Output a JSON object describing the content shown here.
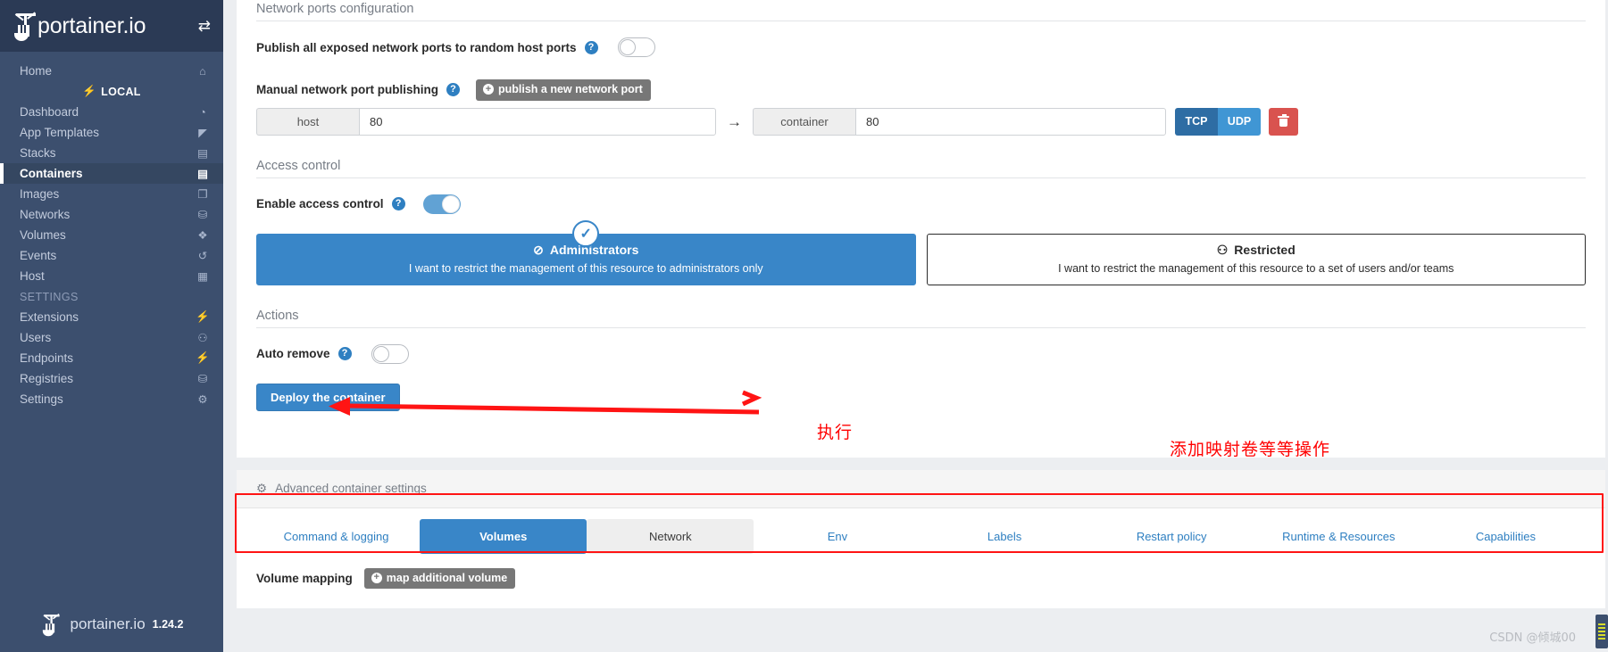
{
  "sidebar": {
    "brand": "portainer.io",
    "toggle_icon": "toggle-sidebar-icon",
    "items": [
      {
        "label": "Home",
        "icon": "home-icon"
      }
    ],
    "local_label": "LOCAL",
    "local_icon": "plug-icon",
    "main_items": [
      {
        "label": "Dashboard",
        "icon": "dashboard-icon",
        "active": false
      },
      {
        "label": "App Templates",
        "icon": "rocket-icon",
        "active": false
      },
      {
        "label": "Stacks",
        "icon": "stacks-icon",
        "active": false
      },
      {
        "label": "Containers",
        "icon": "containers-icon",
        "active": true
      },
      {
        "label": "Images",
        "icon": "images-icon",
        "active": false
      },
      {
        "label": "Networks",
        "icon": "network-icon",
        "active": false
      },
      {
        "label": "Volumes",
        "icon": "volumes-icon",
        "active": false
      },
      {
        "label": "Events",
        "icon": "history-icon",
        "active": false
      },
      {
        "label": "Host",
        "icon": "grid-icon",
        "active": false
      }
    ],
    "settings_header": "SETTINGS",
    "settings_items": [
      {
        "label": "Extensions",
        "icon": "bolt-icon"
      },
      {
        "label": "Users",
        "icon": "users-icon"
      },
      {
        "label": "Endpoints",
        "icon": "plug-icon"
      },
      {
        "label": "Registries",
        "icon": "database-icon"
      },
      {
        "label": "Settings",
        "icon": "gears-icon"
      }
    ],
    "footer_brand": "portainer.io",
    "footer_version": "1.24.2"
  },
  "network_ports": {
    "section_title": "Network ports configuration",
    "publish_all_label": "Publish all exposed network ports to random host ports",
    "publish_all_help": "?",
    "publish_all_state": "off",
    "manual_label": "Manual network port publishing",
    "manual_help": "?",
    "publish_new_button": "publish a new network port",
    "publish_new_icon": "plus-circle-icon",
    "port_row": {
      "host_addon": "host",
      "host_value": "80",
      "arrow": "→",
      "container_addon": "container",
      "container_value": "80",
      "tcp_label": "TCP",
      "udp_label": "UDP",
      "delete_icon": "trash-icon"
    }
  },
  "access_control": {
    "section_title": "Access control",
    "enable_label": "Enable access control",
    "enable_help": "?",
    "enable_state": "on",
    "cards": [
      {
        "title": "Administrators",
        "icon": "eye-slash-icon",
        "subtitle": "I want to restrict the management of this resource to administrators only",
        "selected": true,
        "check_icon": "check-icon"
      },
      {
        "title": "Restricted",
        "icon": "users-group-icon",
        "subtitle": "I want to restrict the management of this resource to a set of users and/or teams",
        "selected": false
      }
    ]
  },
  "actions": {
    "section_title": "Actions",
    "auto_remove_label": "Auto remove",
    "auto_remove_help": "?",
    "auto_remove_state": "off",
    "deploy_button": "Deploy the container"
  },
  "annotations": [
    {
      "text": "执行",
      "color": "#ff0000"
    },
    {
      "text": "添加映射卷等等操作",
      "color": "#ff0000"
    }
  ],
  "advanced": {
    "header": "Advanced container settings",
    "header_icon": "gear-icon",
    "tabs": [
      {
        "label": "Command & logging",
        "state": "normal"
      },
      {
        "label": "Volumes",
        "state": "active"
      },
      {
        "label": "Network",
        "state": "hover"
      },
      {
        "label": "Env",
        "state": "normal"
      },
      {
        "label": "Labels",
        "state": "normal"
      },
      {
        "label": "Restart policy",
        "state": "normal"
      },
      {
        "label": "Runtime & Resources",
        "state": "normal"
      },
      {
        "label": "Capabilities",
        "state": "normal"
      }
    ],
    "volume_mapping_label": "Volume mapping",
    "map_volume_button": "map additional volume",
    "map_volume_icon": "plus-circle-icon"
  },
  "watermark": "CSDN @倾城00",
  "colors": {
    "sidebar_bg": "#3c4f6e",
    "sidebar_brand_bg": "#2b3a55",
    "accent_blue": "#3986c8",
    "tcp_blue": "#2e6da4",
    "udp_blue": "#4096d4",
    "danger_red": "#d9534f",
    "annotation_red": "#ff0000"
  }
}
